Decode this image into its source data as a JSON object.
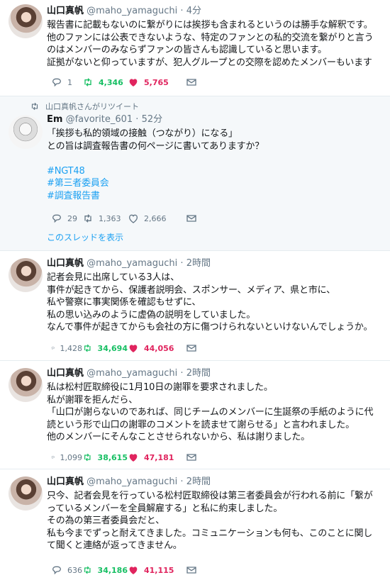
{
  "tweets": [
    {
      "name": "山口真帆",
      "handle": "@maho_yamaguchi",
      "dot": "·",
      "time": "4分",
      "body": [
        "報告書に記載もないのに繋がりには挨拶も含まれるというのは勝手な解釈です。",
        "他のファンには公表できないような、特定のファンとの私的交流を繋がりと言う",
        "のはメンバーのみならずファンの皆さんも認識していると思います。",
        "証拠がないと仰っていますが、犯人グループとの交際を認めたメンバーもいます"
      ],
      "replies": "1",
      "retweets": "4,346",
      "likes": "5,765"
    },
    {
      "retweet_banner": "山口真帆さんがリツイート",
      "name": "Em",
      "handle": "@favorite_601",
      "dot": "·",
      "time": "52分",
      "body": [
        "「挨拶も私的領域の接触（つながり）になる」",
        "との旨は調査報告書の何ページに書いてありますか？",
        ""
      ],
      "hashtags": [
        "#NGT48",
        "#第三者委員会",
        "#調査報告書"
      ],
      "replies": "29",
      "retweets": "1,363",
      "likes": "2,666",
      "thread_link": "このスレッドを表示"
    },
    {
      "name": "山口真帆",
      "handle": "@maho_yamaguchi",
      "dot": "·",
      "time": "2時間",
      "body": [
        "記者会見に出席している3人は、",
        "事件が起きてから、保護者説明会、スポンサー、メディア、県と市に、",
        "私や警察に事実関係を確認もせずに、",
        "私の思い込みのように虚偽の説明をしていました。",
        "なんで事件が起きてからも会社の方に傷つけられないといけないんでしょうか。"
      ],
      "replies": "1,428",
      "retweets": "34,694",
      "likes": "44,056"
    },
    {
      "name": "山口真帆",
      "handle": "@maho_yamaguchi",
      "dot": "·",
      "time": "2時間",
      "body": [
        "私は松村匠取締役に1月10日の謝罪を要求されました。",
        "私が謝罪を拒んだら、",
        "「山口が謝らないのであれば、同じチームのメンバーに生誕祭の手紙のように代",
        "読という形で山口の謝罪のコメントを読ませて謝らせる」と言われました。",
        "他のメンバーにそんなことさせられないから、私は謝りました。"
      ],
      "replies": "1,099",
      "retweets": "38,615",
      "likes": "47,181"
    },
    {
      "name": "山口真帆",
      "handle": "@maho_yamaguchi",
      "dot": "·",
      "time": "2時間",
      "body": [
        "只今、記者会見を行っている松村匠取締役は第三者委員会が行われる前に「繋が",
        "っているメンバーを全員解雇する」と私に約束しました。",
        "その為の第三者委員会だと、",
        "私も今までずっと耐えてきました。コミュニケーションも何も、このことに関し",
        "て聞くと連絡が返ってきません。"
      ],
      "replies": "636",
      "retweets": "34,186",
      "likes": "41,115"
    }
  ],
  "icons": {
    "reply": "reply-icon",
    "retweet": "retweet-icon",
    "like": "heart-icon",
    "dm": "message-icon"
  },
  "colors": {
    "retweet_active": "#17bf63",
    "like_active": "#e0245e",
    "link": "#1da1f2"
  }
}
